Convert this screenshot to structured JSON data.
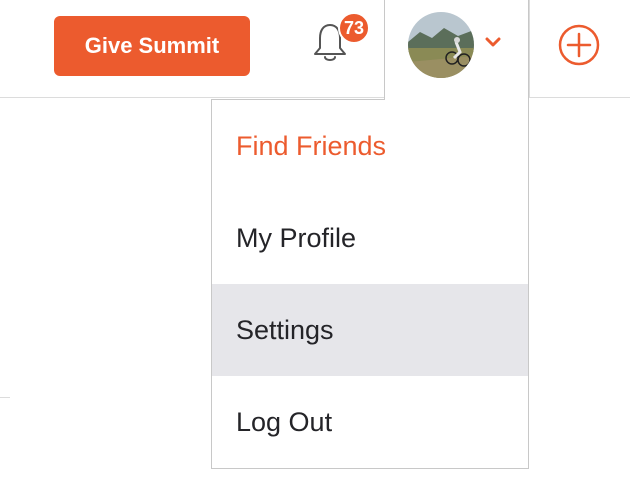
{
  "header": {
    "give_summit_label": "Give Summit",
    "notifications": {
      "icon": "bell-icon",
      "count": "73"
    },
    "profile": {
      "avatar": "avatar-photo",
      "dropdown_icon": "chevron-down-icon"
    },
    "add_icon": "plus-circle-icon"
  },
  "menu": {
    "items": [
      {
        "label": "Find Friends"
      },
      {
        "label": "My Profile"
      },
      {
        "label": "Settings"
      },
      {
        "label": "Log Out"
      }
    ]
  },
  "colors": {
    "brand": "#ec5b2e",
    "menu_text": "#242428",
    "menu_hover_bg": "#e6e6ea",
    "border": "#c8c8c8"
  }
}
